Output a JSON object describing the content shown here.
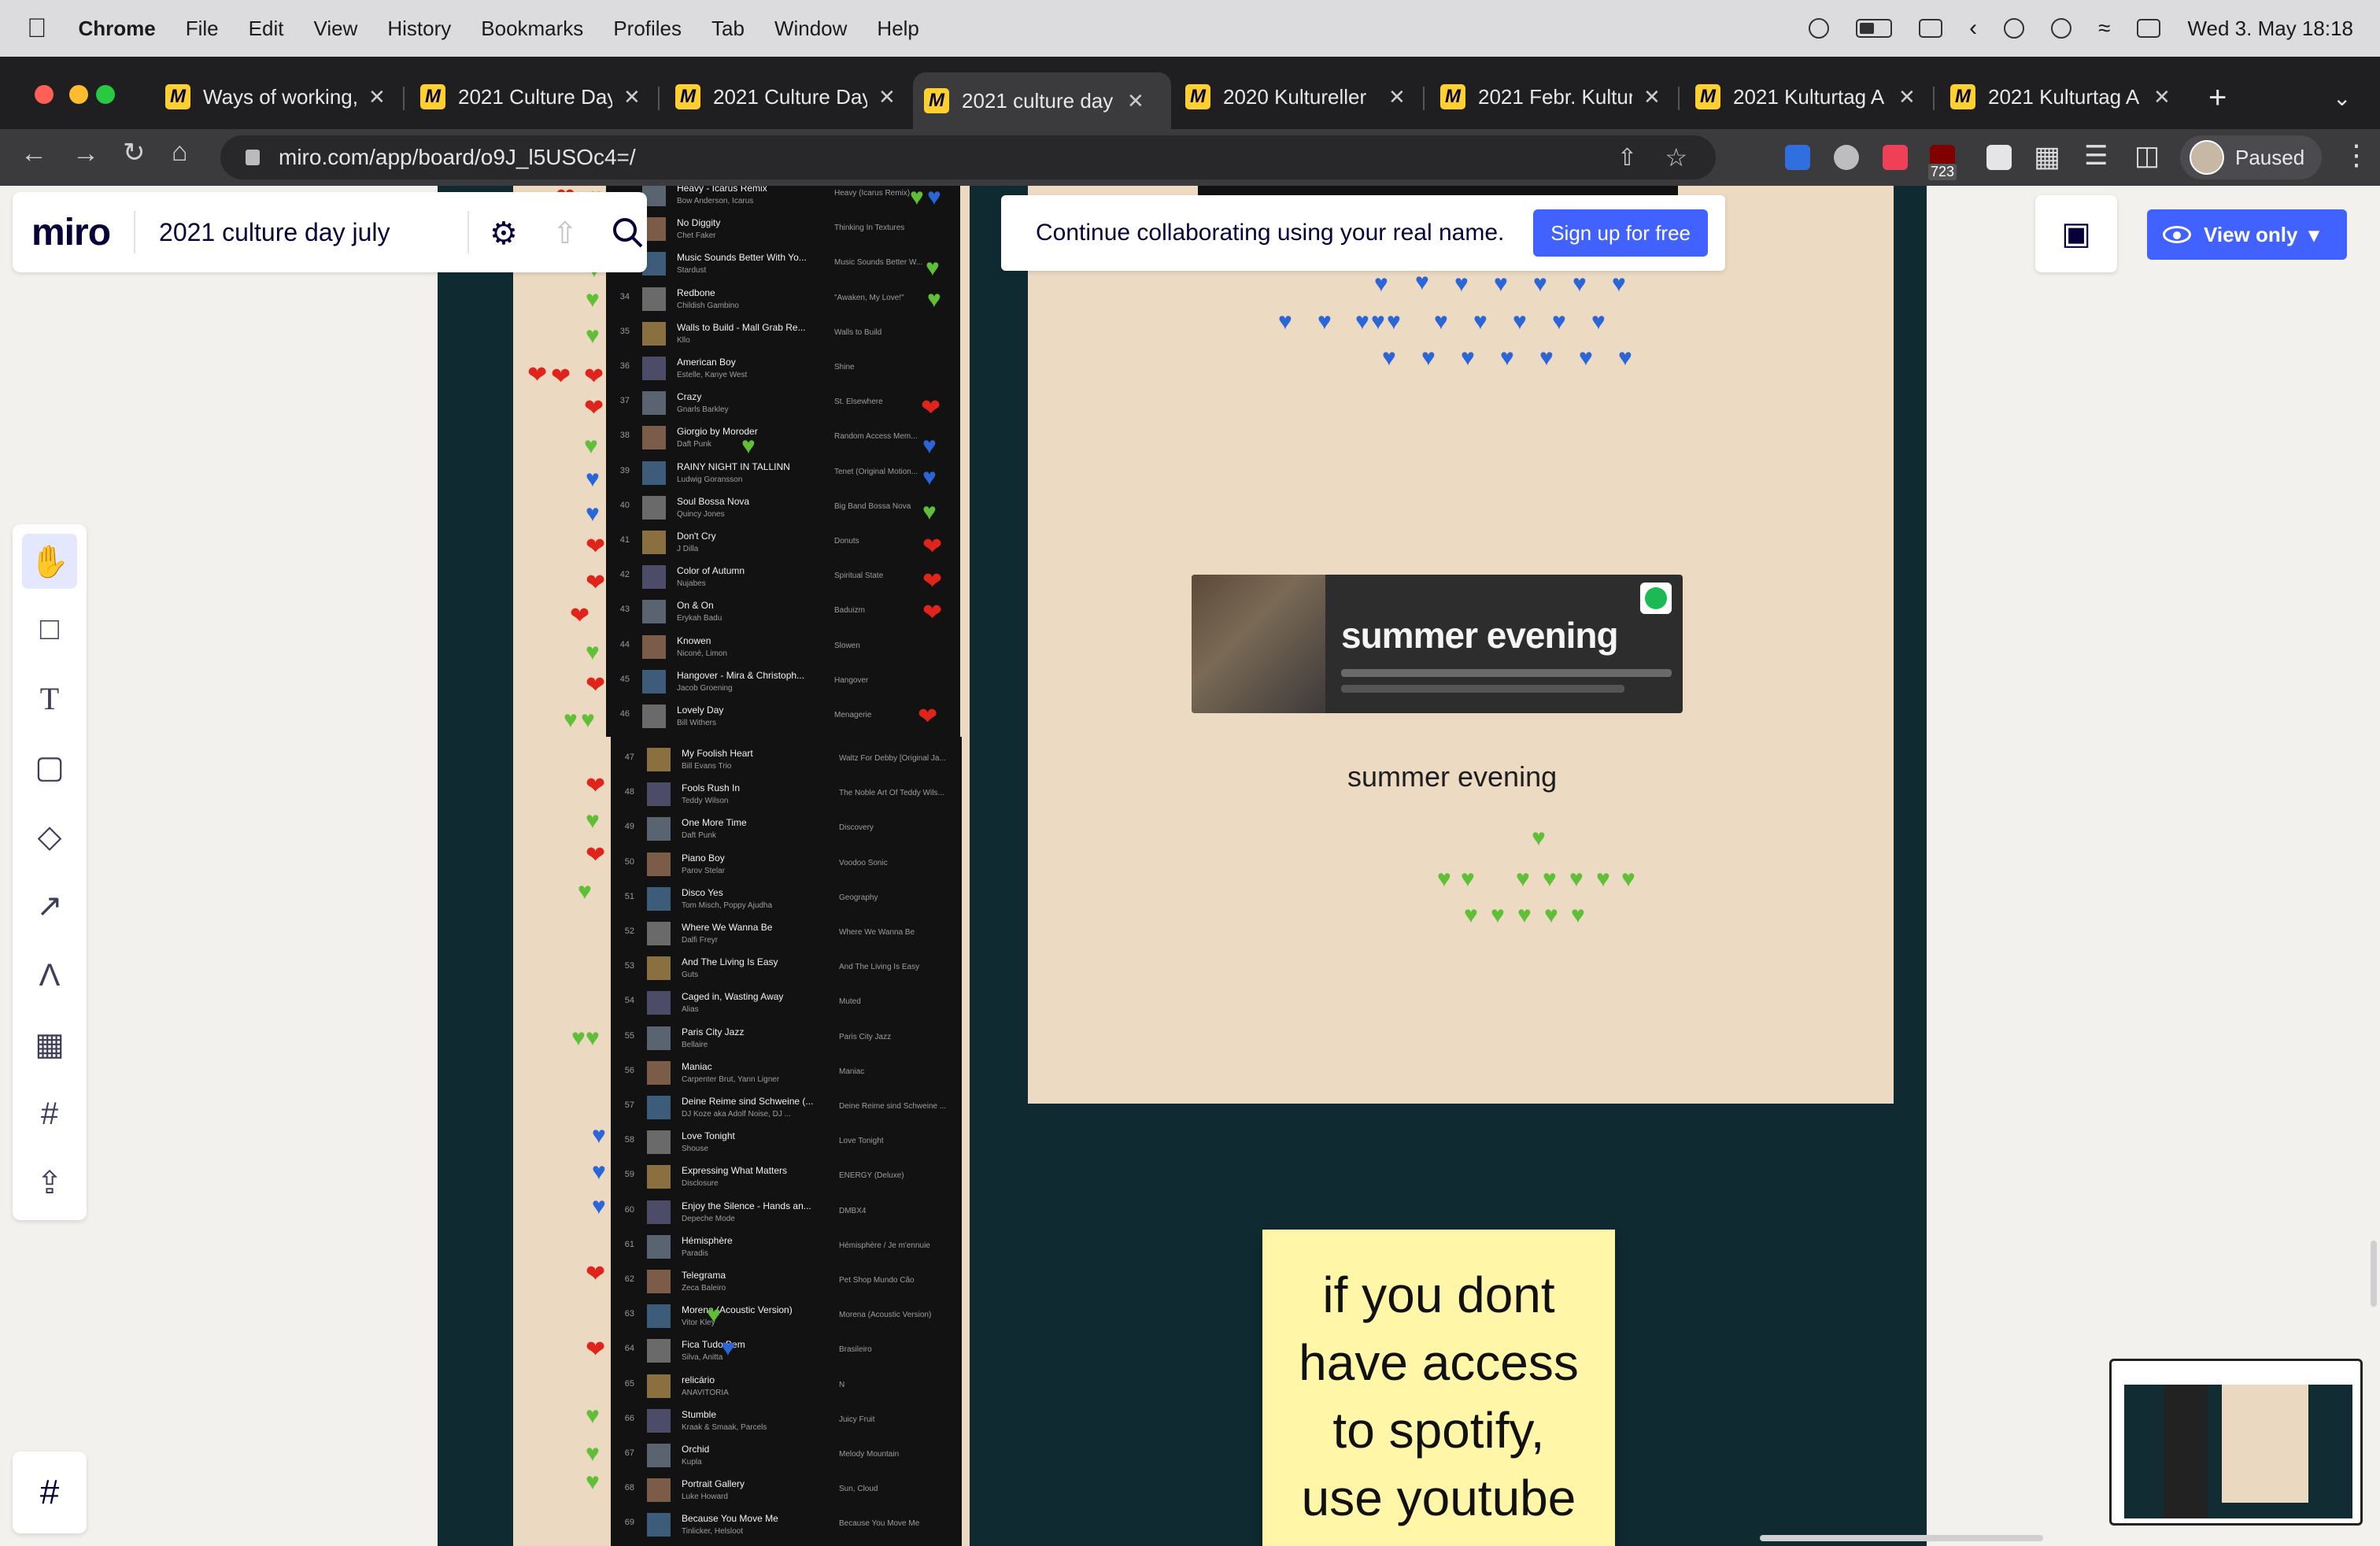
{
  "menubar": {
    "app": "Chrome",
    "items": [
      "File",
      "Edit",
      "View",
      "History",
      "Bookmarks",
      "Profiles",
      "Tab",
      "Window",
      "Help"
    ],
    "datetime": "Wed 3. May  18:18"
  },
  "tabs": [
    {
      "title": "Ways of working,",
      "active": false
    },
    {
      "title": "2021 Culture Day",
      "active": false
    },
    {
      "title": "2021 Culture Day",
      "active": false
    },
    {
      "title": "2021 culture day",
      "active": true
    },
    {
      "title": "2020 Kultureller",
      "active": false
    },
    {
      "title": "2021 Febr. Kultur",
      "active": false
    },
    {
      "title": "2021 Kulturtag A",
      "active": false
    },
    {
      "title": "2021 Kulturtag A",
      "active": false
    }
  ],
  "address": {
    "url": "miro.com/app/board/o9J_l5USOc4=/",
    "badge": "723",
    "profile": "Paused"
  },
  "miro": {
    "logo": "miro",
    "board_name": "2021 culture day july",
    "banner_text": "Continue collaborating using your real name.",
    "signup_label": "Sign up for free",
    "view_label": "View only"
  },
  "playlist": [
    {
      "n": "",
      "title": "Heavy - Icarus Remix",
      "artist": "Bow Anderson, Icarus",
      "album": "Heavy (Icarus Remix)"
    },
    {
      "n": "",
      "title": "No Diggity",
      "artist": "Chet Faker",
      "album": "Thinking In Textures"
    },
    {
      "n": "",
      "title": "Music Sounds Better With Yo...",
      "artist": "Stardust",
      "album": "Music Sounds Better W..."
    },
    {
      "n": "34",
      "title": "Redbone",
      "artist": "Childish Gambino",
      "album": "\"Awaken, My Love!\""
    },
    {
      "n": "35",
      "title": "Walls to Build - Mall Grab Re...",
      "artist": "Kllo",
      "album": "Walls to Build"
    },
    {
      "n": "36",
      "title": "American Boy",
      "artist": "Estelle, Kanye West",
      "album": "Shine"
    },
    {
      "n": "37",
      "title": "Crazy",
      "artist": "Gnarls Barkley",
      "album": "St. Elsewhere"
    },
    {
      "n": "38",
      "title": "Giorgio by Moroder",
      "artist": "Daft Punk",
      "album": "Random Access Mem..."
    },
    {
      "n": "39",
      "title": "RAINY NIGHT IN TALLINN",
      "artist": "Ludwig Goransson",
      "album": "Tenet (Original Motion..."
    },
    {
      "n": "40",
      "title": "Soul Bossa Nova",
      "artist": "Quincy Jones",
      "album": "Big Band Bossa Nova"
    },
    {
      "n": "41",
      "title": "Don't Cry",
      "artist": "J Dilla",
      "album": "Donuts"
    },
    {
      "n": "42",
      "title": "Color of Autumn",
      "artist": "Nujabes",
      "album": "Spiritual State"
    },
    {
      "n": "43",
      "title": "On & On",
      "artist": "Erykah Badu",
      "album": "Baduizm"
    },
    {
      "n": "44",
      "title": "Knowen",
      "artist": "Niconé, Limon",
      "album": "Slowen"
    },
    {
      "n": "45",
      "title": "Hangover - Mira & Christoph...",
      "artist": "Jacob Groening",
      "album": "Hangover"
    },
    {
      "n": "46",
      "title": "Lovely Day",
      "artist": "Bill Withers",
      "album": "Menagerie"
    },
    {
      "n": "47",
      "title": "My Foolish Heart",
      "artist": "Bill Evans Trio",
      "album": "Waltz For Debby [Original Ja..."
    },
    {
      "n": "48",
      "title": "Fools Rush In",
      "artist": "Teddy Wilson",
      "album": "The Noble Art Of Teddy Wils..."
    },
    {
      "n": "49",
      "title": "One More Time",
      "artist": "Daft Punk",
      "album": "Discovery"
    },
    {
      "n": "50",
      "title": "Piano Boy",
      "artist": "Parov Stelar",
      "album": "Voodoo Sonic"
    },
    {
      "n": "51",
      "title": "Disco Yes",
      "artist": "Tom Misch, Poppy Ajudha",
      "album": "Geography"
    },
    {
      "n": "52",
      "title": "Where We Wanna Be",
      "artist": "Dalfi Freyr",
      "album": "Where We Wanna Be"
    },
    {
      "n": "53",
      "title": "And The Living Is Easy",
      "artist": "Guts",
      "album": "And The Living Is Easy"
    },
    {
      "n": "54",
      "title": "Caged in, Wasting Away",
      "artist": "Alias",
      "album": "Muted"
    },
    {
      "n": "55",
      "title": "Paris City Jazz",
      "artist": "Bellaire",
      "album": "Paris City Jazz"
    },
    {
      "n": "56",
      "title": "Maniac",
      "artist": "Carpenter Brut, Yann Ligner",
      "album": "Maniac"
    },
    {
      "n": "57",
      "title": "Deine Reime sind Schweine (...",
      "artist": "DJ Koze aka Adolf Noise, DJ ...",
      "album": "Deine Reime sind Schweine ..."
    },
    {
      "n": "58",
      "title": "Love Tonight",
      "artist": "Shouse",
      "album": "Love Tonight"
    },
    {
      "n": "59",
      "title": "Expressing What Matters",
      "artist": "Disclosure",
      "album": "ENERGY (Deluxe)"
    },
    {
      "n": "60",
      "title": "Enjoy the Silence - Hands an...",
      "artist": "Depeche Mode",
      "album": "DMBX4"
    },
    {
      "n": "61",
      "title": "Hémisphère",
      "artist": "Paradis",
      "album": "Hémisphère / Je m'ennuie"
    },
    {
      "n": "62",
      "title": "Telegrama",
      "artist": "Zeca Baleiro",
      "album": "Pet Shop Mundo Cão"
    },
    {
      "n": "63",
      "title": "Morena (Acoustic Version)",
      "artist": "Vitor Kley",
      "album": "Morena (Acoustic Version)"
    },
    {
      "n": "64",
      "title": "Fica Tudo Bem",
      "artist": "Silva, Anitta",
      "album": "Brasileiro"
    },
    {
      "n": "65",
      "title": "relicário",
      "artist": "ANAVITÓRIA",
      "album": "N"
    },
    {
      "n": "66",
      "title": "Stumble",
      "artist": "Kraak & Smaak, Parcels",
      "album": "Juicy Fruit"
    },
    {
      "n": "67",
      "title": "Orchid",
      "artist": "Kupla",
      "album": "Melody Mountain"
    },
    {
      "n": "68",
      "title": "Portrait Gallery",
      "artist": "Luke Howard",
      "album": "Sun, Cloud"
    },
    {
      "n": "69",
      "title": "Because You Move Me",
      "artist": "Tinlicker, Helsloot",
      "album": "Because You Move Me"
    }
  ],
  "spotify_card": {
    "name": "summer evening"
  },
  "caption": "summer evening",
  "sticky_note": {
    "lines": [
      "if you dont",
      "have access",
      "to spotify,",
      "use youtube"
    ]
  },
  "colors": {
    "heart_red": "#e0241c",
    "heart_green": "#5fbf36",
    "heart_blue": "#2a66d8",
    "miro_blue": "#4262ff",
    "sticky": "#fff6a8"
  }
}
